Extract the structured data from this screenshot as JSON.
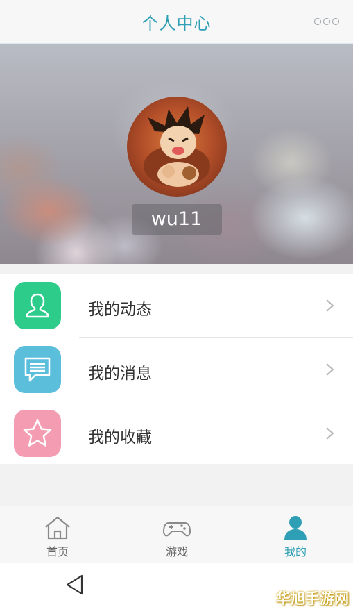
{
  "header": {
    "title": "个人中心",
    "more_icon": "more-icon"
  },
  "profile": {
    "username": "wu11",
    "avatar_icon": "avatar-image"
  },
  "menu": {
    "items": [
      {
        "label": "我的动态",
        "icon": "user-icon",
        "icon_color": "#2dcc8a"
      },
      {
        "label": "我的消息",
        "icon": "message-icon",
        "icon_color": "#5bbfdc"
      },
      {
        "label": "我的收藏",
        "icon": "star-icon",
        "icon_color": "#f39cb2"
      }
    ]
  },
  "tabbar": {
    "tabs": [
      {
        "label": "首页",
        "icon": "home-icon",
        "active": false
      },
      {
        "label": "游戏",
        "icon": "gamepad-icon",
        "active": false
      },
      {
        "label": "我的",
        "icon": "profile-icon",
        "active": true
      }
    ],
    "accent": "#2e9fb4"
  },
  "system_nav": {
    "back_icon": "back-triangle-icon"
  },
  "watermark": "华旭手游网"
}
